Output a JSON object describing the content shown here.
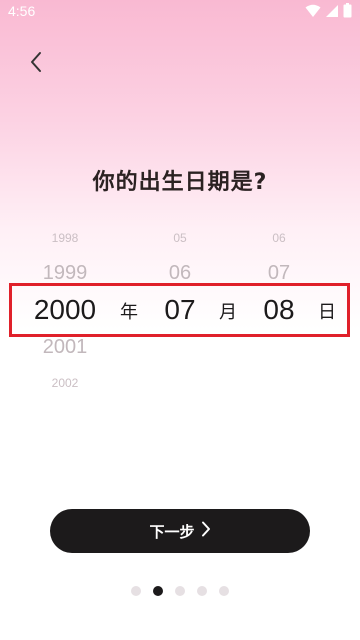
{
  "status_bar": {
    "time": "4:56",
    "icons": [
      "wifi-icon",
      "cellular-signal-icon",
      "battery-icon"
    ]
  },
  "header": {
    "back_icon": "chevron-left-icon"
  },
  "title": "你的出生日期是?",
  "picker": {
    "year": {
      "above_far": "1998",
      "above_near": "1999",
      "selected": "2000",
      "below_near": "2001",
      "below_far": "2002",
      "unit": "年"
    },
    "month": {
      "above_far": "05",
      "above_near": "06",
      "selected": "07",
      "unit": "月"
    },
    "day": {
      "above_far": "06",
      "above_near": "07",
      "selected": "08",
      "unit": "日"
    }
  },
  "next_button": {
    "label": "下一步",
    "icon": "chevron-right-icon"
  },
  "pagination": {
    "total": 5,
    "active_index": 1
  },
  "colors": {
    "highlight_border": "#e0202a",
    "button_bg": "#1c1a1b",
    "gradient_top": "#f9b9d2"
  }
}
